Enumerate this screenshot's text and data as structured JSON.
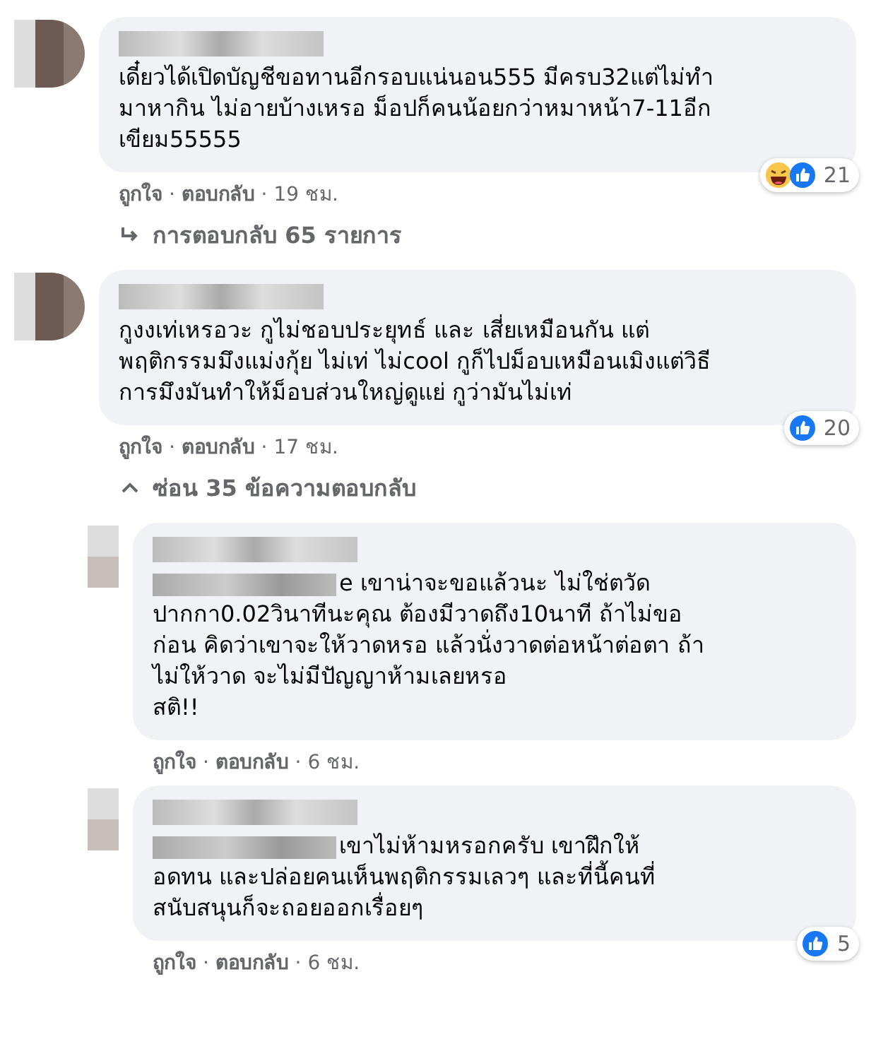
{
  "comments": [
    {
      "text": "เดี๋ยวได้เปิดบัญชีขอทานอีกรอบแน่นอน555 มีครบ32แต่ไม่ทำ\nมาหากิน ไม่อายบ้างเหรอ ม็อปก็คนน้อยกว่าหมาหน้า7-11อีก\nเขียม55555",
      "reactions": {
        "icons": [
          {
            "kind": "haha"
          },
          {
            "kind": "like"
          }
        ],
        "count": "21"
      },
      "actions": "**ถูกใจ** · **ตอบกลับ** · 19 ชม.",
      "replies_toggle": {
        "kind": "show",
        "label": "การตอบกลับ 65 รายการ"
      }
    },
    {
      "text": "กูงงเท่เหรอวะ กูไม่ชอบประยุทธ์ และ เสี่ยเหมือนกัน แต่\nพฤติกรรมมึงแม่งกุ้ย ไม่เท่ ไม่cool กูก็ไปม็อบเหมือนเมิงแต่วิธี\nการมึงมันทำให้ม็อบส่วนใหญ่ดูแย่ กูว่ามันไม่เท่",
      "reactions": {
        "icons": [
          {
            "kind": "like"
          }
        ],
        "count": "20"
      },
      "actions": "**ถูกใจ** · **ตอบกลับ** · 17 ชม.",
      "replies_toggle": {
        "kind": "hide",
        "label": "ซ่อน 35 ข้อความตอบกลับ"
      },
      "replies": [
        {
          "text": "e เขาน่าจะขอแล้วนะ ไม่ใช่ตวัด\nปากกา0.02วินาทีนะคุณ ต้องมีวาดถึง10นาที ถ้าไม่ขอ\nก่อน คิดว่าเขาจะให้วาดหรอ แล้วนั่งวาดต่อหน้าต่อตา ถ้า\nไม่ให้วาด จะไม่มีปัญญาห้ามเลยหรอ\nสติ!!",
          "actions": "**ถูกใจ** · **ตอบกลับ** · 6 ชม."
        },
        {
          "text": "เขาไม่ห้ามหรอกครับ เขาฝึกให้\nอดทน และปล่อยคนเห็นพฤติกรรมเลวๆ และที่นี้คนที่\nสนับสนุนก็จะถอยออกเรื่อยๆ",
          "reactions": {
            "icons": [
              {
                "kind": "like"
              }
            ],
            "count": "5"
          },
          "actions": "**ถูกใจ** · **ตอบกลับ** · 6 ชม."
        }
      ]
    }
  ]
}
